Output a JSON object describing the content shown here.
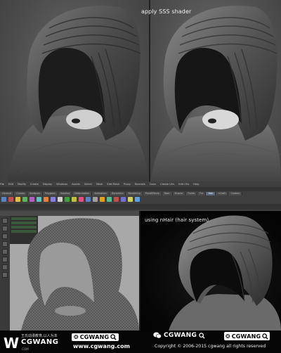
{
  "panels": {
    "top_left_caption": "",
    "top_right_caption": "apply SSS shader",
    "bottom_right_caption": "using nHair (hair system)"
  },
  "maya": {
    "menu_items": [
      "File",
      "Edit",
      "Modify",
      "Create",
      "Display",
      "Windows",
      "Assets",
      "Select",
      "Mesh",
      "Edit Mesh",
      "Proxy",
      "Normals",
      "Color",
      "Create UVs",
      "Edit UVs",
      "Help"
    ],
    "shelf_tabs": [
      "General",
      "Curves",
      "Surfaces",
      "Polygons",
      "Subdivs",
      "Deformation",
      "Animation",
      "Dynamics",
      "Rendering",
      "PaintEffects",
      "Toon",
      "Muscle",
      "Fluids",
      "Fur",
      "Hair",
      "nCloth",
      "Custom"
    ],
    "active_shelf_tab_index": 14,
    "shelf_icon_colors": [
      "#5a84c0",
      "#c05050",
      "#e0c040",
      "#60b060",
      "#b060c0",
      "#60c0c0",
      "#e08040",
      "#8080e0",
      "#d0d0d0",
      "#40a040",
      "#c0c040",
      "#e05080",
      "#5a84c0",
      "#a0a0a0",
      "#e0a020",
      "#50c090",
      "#c05050",
      "#7070d0",
      "#d0d060",
      "#60a0e0"
    ]
  },
  "footer": {
    "logo_letter": "W",
    "logo_cn": "王氏动漫教育,以人为本",
    "logo_name": "CGWANG",
    "logo_sub": ".COM",
    "search_badge_left": "CGWANG",
    "site_url": "www.cgwang.com",
    "wechat_name": "CGWANG",
    "search_badge_right": "CGWANG",
    "copyright": "Copyright  ©  2006-2015 cgwang all rights reserved"
  },
  "colors": {
    "hood_dark": "#3a3a3a",
    "hood_mid": "#5a5a5a",
    "hood_light": "#8a8a8a",
    "render_bg_dark": "#060606",
    "footer_bg": "#050505"
  }
}
